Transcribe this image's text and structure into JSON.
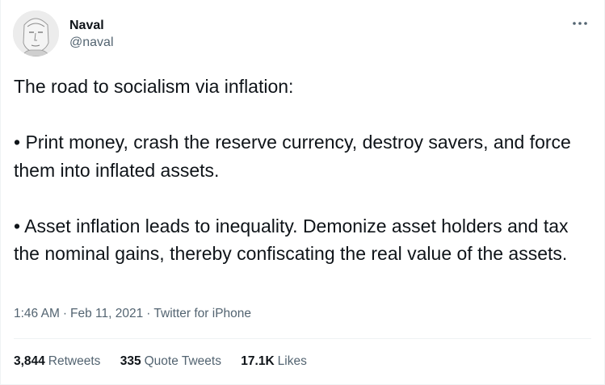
{
  "author": {
    "name": "Naval",
    "handle": "@naval"
  },
  "more_icon": "more-horizontal-icon",
  "tweet": {
    "lines": [
      "The road to socialism via inflation:",
      "• Print money, crash the reserve currency, destroy savers, and force them into inflated assets.",
      "• Asset inflation leads to inequality. Demonize asset holders and tax the nominal gains, thereby confiscating the real value of the assets."
    ]
  },
  "meta": {
    "time": "1:46 AM",
    "date": "Feb 11, 2021",
    "source": "Twitter for iPhone",
    "separator": "·"
  },
  "stats": {
    "retweets_count": "3,844",
    "retweets_label": "Retweets",
    "quotes_count": "335",
    "quotes_label": "Quote Tweets",
    "likes_count": "17.1K",
    "likes_label": "Likes"
  },
  "colors": {
    "text": "#0f1419",
    "secondary": "#536471",
    "divider": "#eff3f4"
  }
}
